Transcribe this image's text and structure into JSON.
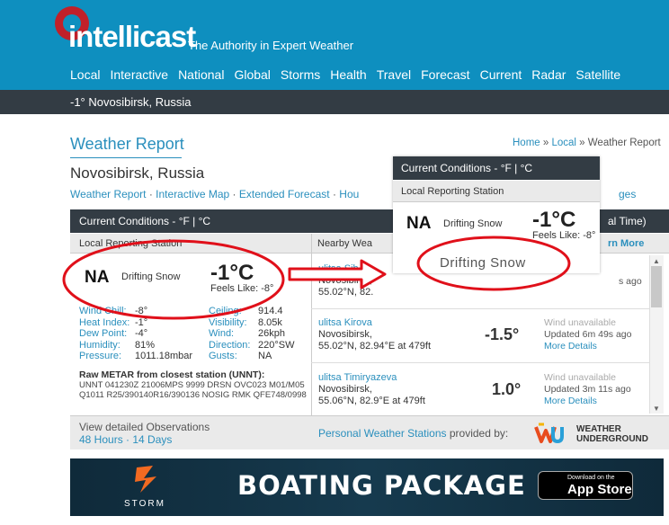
{
  "header": {
    "logo": "intellicast",
    "tagline": "The Authority in Expert Weather",
    "nav": [
      "Local",
      "Interactive",
      "National",
      "Global",
      "Storms",
      "Health",
      "Travel",
      "Forecast",
      "Current",
      "Radar",
      "Satellite"
    ]
  },
  "location_bar": "-1° Novosibirsk, Russia",
  "page": {
    "title": "Weather Report",
    "breadcrumb": {
      "home": "Home",
      "sep1": " » ",
      "local": "Local",
      "sep2": " » ",
      "current": "Weather Report"
    },
    "city": "Novosibirsk, Russia",
    "subnav": [
      "Weather Report",
      "Interactive Map",
      "Extended Forecast",
      "Hou"
    ],
    "subnav_sep": " · ",
    "subnav_right": "ges"
  },
  "current": {
    "header": "Current Conditions -  °F | °C",
    "station_label": "Local Reporting Station",
    "station_code": "NA",
    "condition": "Drifting Snow",
    "temp": "-1°C",
    "feels_like": "Feels Like: -8°",
    "details_left": [
      {
        "label": "Wind Chill:",
        "value": "-8°"
      },
      {
        "label": "Heat Index:",
        "value": "-1°"
      },
      {
        "label": "Dew Point:",
        "value": "-4°"
      },
      {
        "label": "Humidity:",
        "value": "81%"
      },
      {
        "label": "Pressure:",
        "value": "1011.18mbar"
      }
    ],
    "details_right": [
      {
        "label": "Ceiling:",
        "value": "914.4"
      },
      {
        "label": "Visibility:",
        "value": "8.05k"
      },
      {
        "label": "Wind:",
        "value": "26kph"
      },
      {
        "label": "Direction:",
        "value": "220°SW"
      },
      {
        "label": "Gusts:",
        "value": "NA"
      }
    ],
    "metar_heading": "Raw METAR from closest station (UNNT):",
    "metar_lines": [
      "UNNT 041230Z 21006MPS 9999 DRSN OVC023 M01/M05",
      "Q1011 R25/390140R16/390136 NOSIG RMK QFE748/0998"
    ],
    "observations_text": "View detailed Observations",
    "observations_links": [
      "48 Hours",
      "14 Days"
    ],
    "observations_sep": " · "
  },
  "nearby": {
    "header_right": "al Time)",
    "label": "Nearby Wea",
    "learn_more": "rn More",
    "stations": [
      {
        "name": "ulitsa Sib",
        "city": "Novosibirsk,",
        "coords": "55.02°N, 82.",
        "temp": "",
        "wind": "",
        "updated": "s ago",
        "more": ""
      },
      {
        "name": "ulitsa Kirova",
        "city": "Novosibirsk,",
        "coords": "55.02°N, 82.94°E at 479ft",
        "temp": "-1.5°",
        "wind": "Wind unavailable",
        "updated": "Updated 6m 49s ago",
        "more": "More Details"
      },
      {
        "name": "ulitsa Timiryazeva",
        "city": "Novosibirsk,",
        "coords": "55.06°N, 82.9°E at 479ft",
        "temp": "1.0°",
        "wind": "Wind unavailable",
        "updated": "Updated 3m 11s ago",
        "more": "More Details"
      }
    ],
    "pws_link": "Personal Weather Stations",
    "pws_suffix": " provided by:",
    "wu_line1": "WEATHER",
    "wu_line2": "UNDERGROUND"
  },
  "popup": {
    "header": "Current Conditions -  °F | °C",
    "station_label": "Local Reporting Station",
    "station_code": "NA",
    "condition": "Drifting Snow",
    "temp": "-1°C",
    "feels_like": "Feels Like: -8°",
    "zoomed_condition": "Drifting Snow"
  },
  "banner": {
    "brand": "STORM",
    "title": "BOATING PACKAGE",
    "store_small": "Download on the",
    "store_big": "App Store"
  },
  "colors": {
    "header_blue": "#0e8fbf",
    "dark_bar": "#333c44",
    "link_blue": "#2a8fbd",
    "annotation_red": "#e0101a"
  }
}
